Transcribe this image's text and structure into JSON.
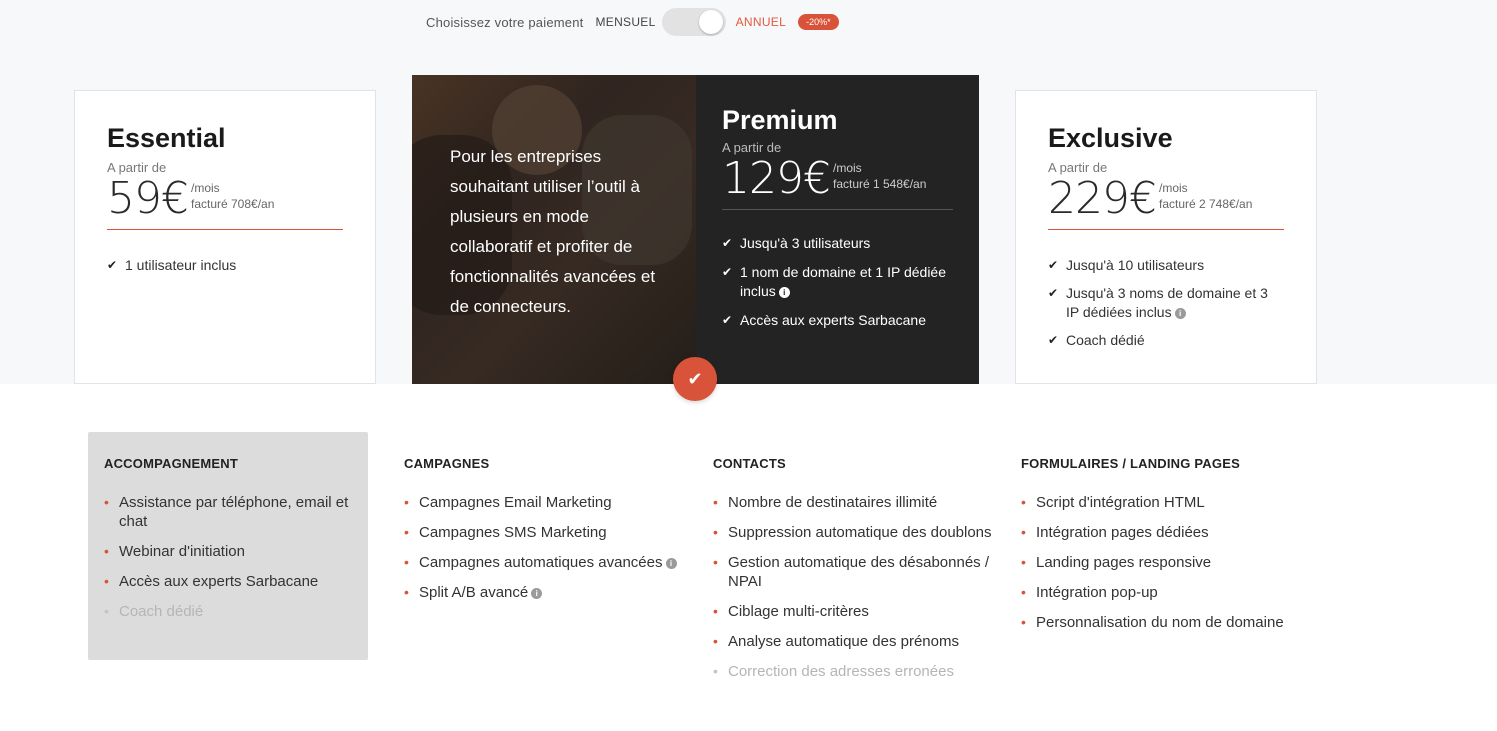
{
  "billing": {
    "label": "Choisissez votre paiement",
    "monthly": "MENSUEL",
    "annual": "ANNUEL",
    "discount": "-20%*",
    "annual_selected": true
  },
  "plans": {
    "essential": {
      "name": "Essential",
      "from": "A partir de",
      "price": "59€",
      "per": "/mois",
      "billed": "facturé 708€/an",
      "features": [
        "1 utilisateur inclus"
      ]
    },
    "premium": {
      "description": "Pour les entreprises souhaitant utiliser l’outil à plusieurs en mode collaboratif et profiter de fonctionnalités avancées et de connecteurs.",
      "name": "Premium",
      "from": "A partir de",
      "price": "129€",
      "per": "/mois",
      "billed": "facturé 1 548€/an",
      "features": [
        "Jusqu'à 3 utilisateurs",
        "1 nom de domaine et 1 IP dédiée inclus",
        "Accès aux experts Sarbacane"
      ]
    },
    "exclusive": {
      "name": "Exclusive",
      "from": "A partir de",
      "price": "229€",
      "per": "/mois",
      "billed": "facturé 2 748€/an",
      "features": [
        "Jusqu'à 10 utilisateurs",
        "Jusqu'à 3 noms de domaine et 3 IP dédiées inclus",
        "Coach dédié"
      ]
    }
  },
  "info_icon": "i",
  "selected_icon": "✔",
  "sections": {
    "accompagnement": {
      "title": "ACCOMPAGNEMENT",
      "items": [
        "Assistance par téléphone, email et chat",
        "Webinar d'initiation",
        "Accès aux experts Sarbacane",
        "Coach dédié"
      ]
    },
    "campagnes": {
      "title": "CAMPAGNES",
      "items": [
        "Campagnes Email Marketing",
        "Campagnes SMS Marketing",
        "Campagnes automatiques avancées",
        "Split A/B avancé"
      ]
    },
    "contacts": {
      "title": "CONTACTS",
      "items": [
        "Nombre de destinataires illimité",
        "Suppression automatique des doublons",
        "Gestion automatique des désabonnés / NPAI",
        "Ciblage multi-critères",
        "Analyse automatique des prénoms",
        "Correction des adresses erronées"
      ]
    },
    "formulaires": {
      "title": "FORMULAIRES / LANDING PAGES",
      "items": [
        "Script d'intégration HTML",
        "Intégration pages dédiées",
        "Landing pages responsive",
        "Intégration pop-up",
        "Personnalisation du nom de domaine"
      ]
    }
  },
  "colors": {
    "accent": "#d9533a",
    "premium_bg": "#232323",
    "section_bg": "#dcdcdc"
  }
}
